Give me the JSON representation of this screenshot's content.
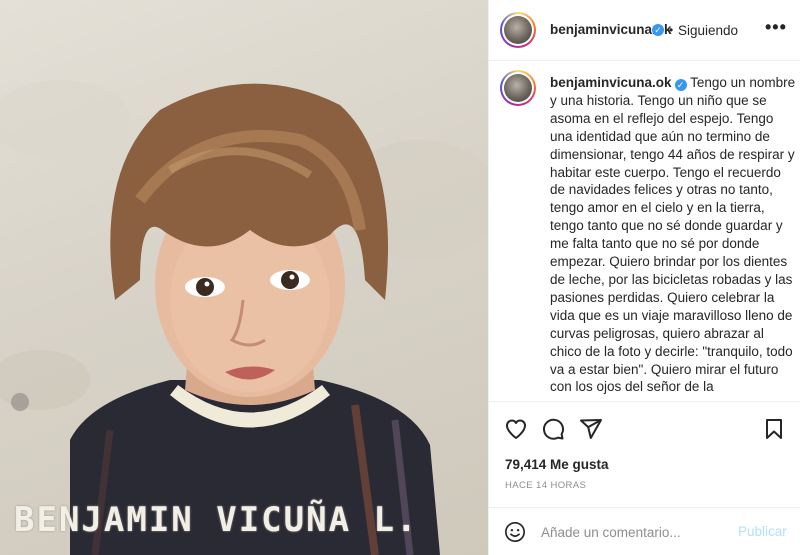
{
  "post": {
    "photo_caption": "BENJAMIN VICUÑA L."
  },
  "header": {
    "username": "benjaminvicuna.ok",
    "verified_badge": "✓",
    "separator": "•",
    "follow_status": "Siguiendo",
    "more_label": "•••"
  },
  "caption": {
    "username": "benjaminvicuna.ok",
    "verified_badge": "✓",
    "text": "Tengo un nombre y una historia. Tengo un niño que se asoma en el reflejo del espejo. Tengo una identidad que aún no termino de dimensionar, tengo 44 años de respirar y habitar este cuerpo. Tengo el recuerdo de navidades felices y otras no tanto, tengo amor en el cielo y en la tierra, tengo tanto que no sé donde guardar y me falta tanto que no sé por donde empezar. Quiero brindar por los dientes de leche, por las bicicletas robadas y las pasiones perdidas. Quiero celebrar la vida que es un viaje maravilloso lleno de curvas peligrosas, quiero abrazar al chico de la foto y decirle: \"tranquilo, todo va a estar bien\". Quiero mirar el futuro con los ojos del señor de la"
  },
  "actions": {
    "icons": [
      "heart-icon",
      "comment-icon",
      "share-icon",
      "bookmark-icon"
    ]
  },
  "likes": {
    "text": "79,414 Me gusta"
  },
  "time": {
    "text": "HACE 14 HORAS"
  },
  "comment": {
    "placeholder": "Añade un comentario...",
    "publish_label": "Publicar"
  },
  "colors": {
    "link_disabled": "#b2dffc",
    "verified": "#3897f0",
    "muted": "#8e8e8e",
    "text": "#262626"
  }
}
